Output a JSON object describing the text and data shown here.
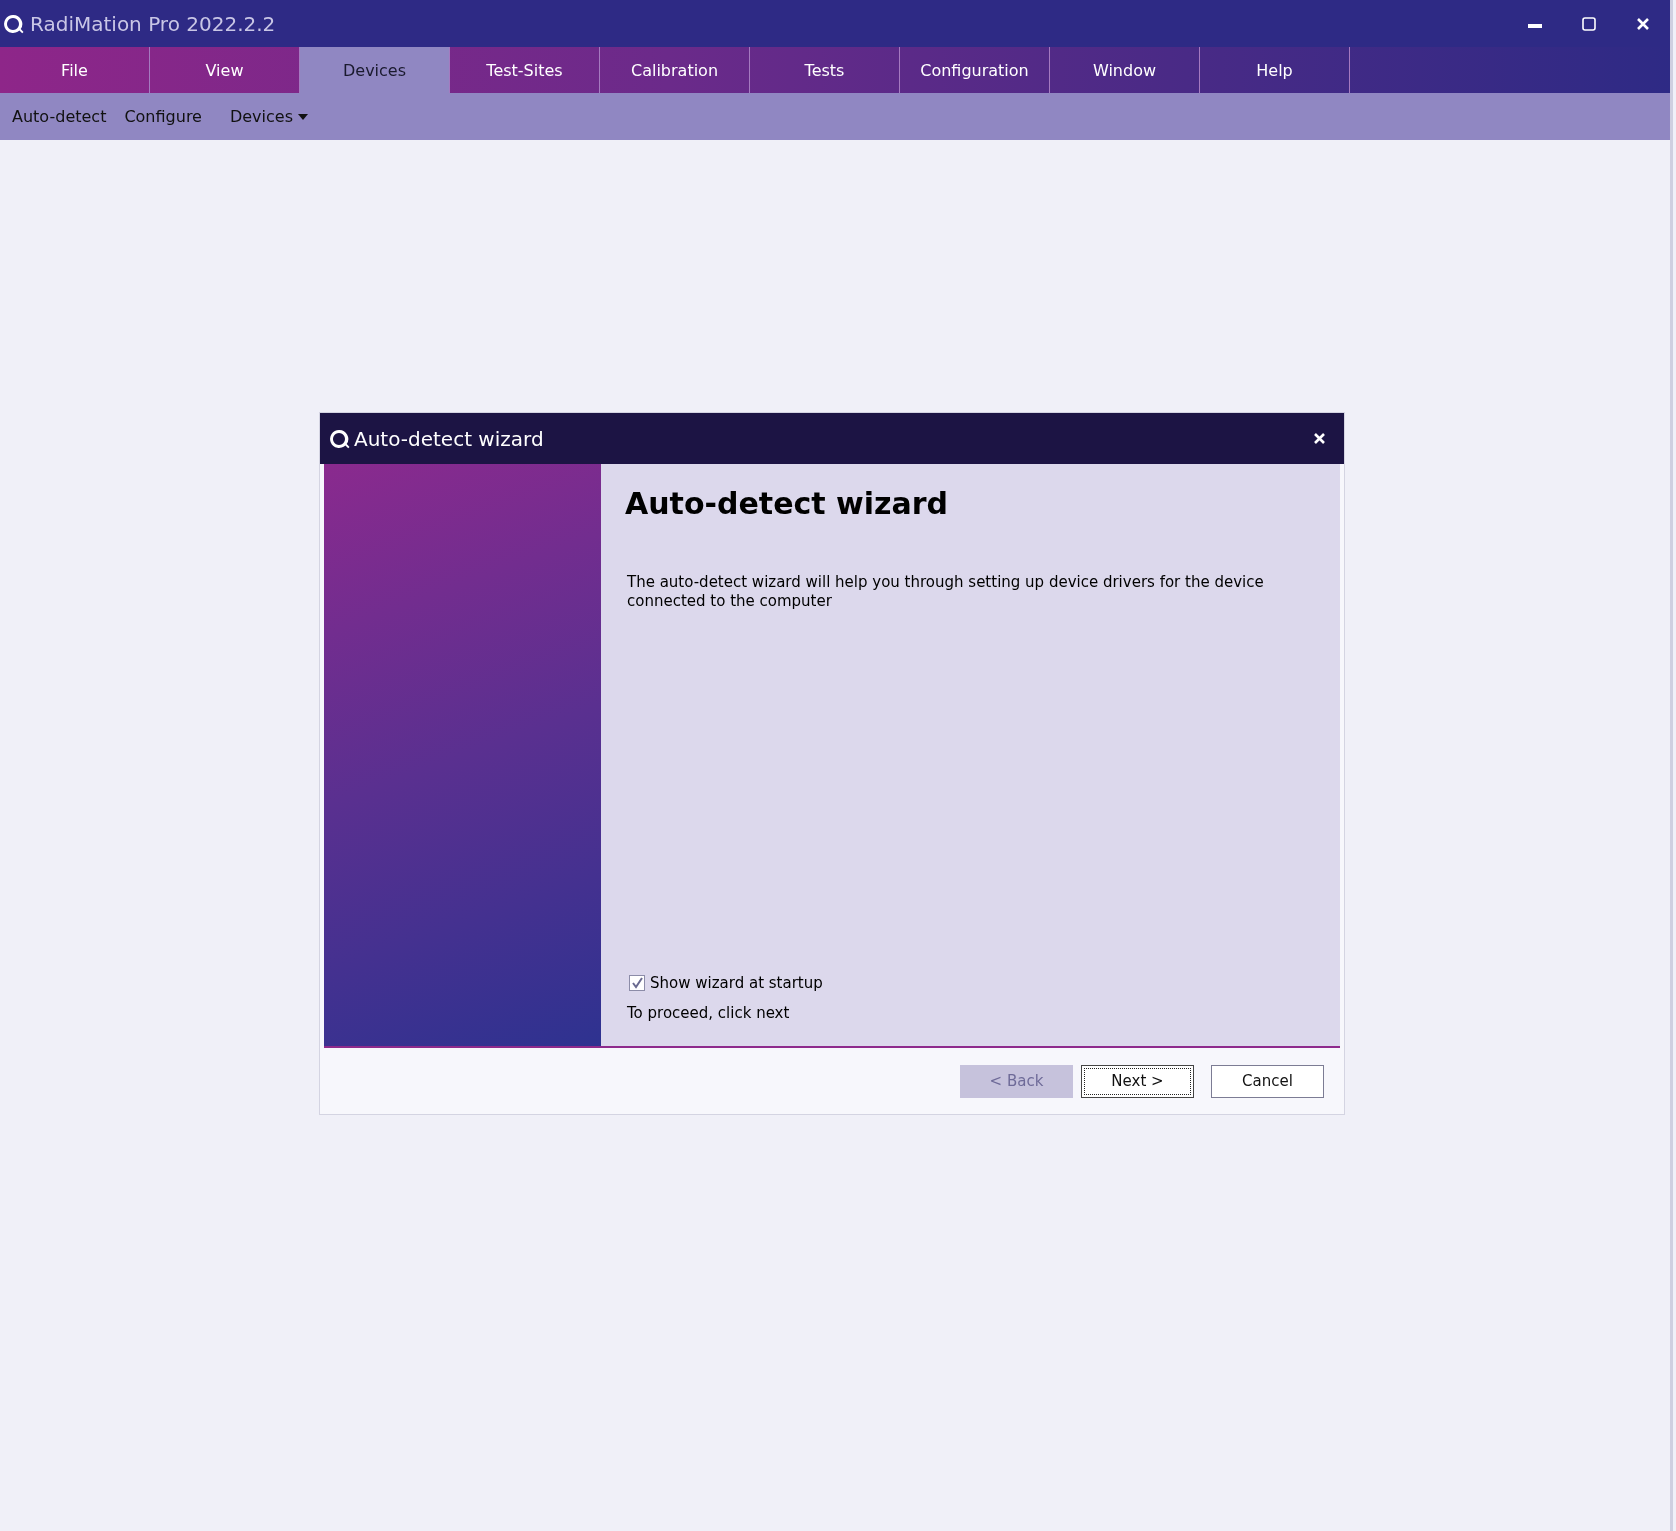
{
  "window": {
    "title": "RadiMation Pro 2022.2.2"
  },
  "menu_tabs": [
    {
      "label": "File",
      "selected": false
    },
    {
      "label": "View",
      "selected": false
    },
    {
      "label": "Devices",
      "selected": true
    },
    {
      "label": "Test-Sites",
      "selected": false
    },
    {
      "label": "Calibration",
      "selected": false
    },
    {
      "label": "Tests",
      "selected": false
    },
    {
      "label": "Configuration",
      "selected": false
    },
    {
      "label": "Window",
      "selected": false
    },
    {
      "label": "Help",
      "selected": false
    }
  ],
  "toolbar": [
    {
      "label": "Auto-detect",
      "kind": "button"
    },
    {
      "label": "Configure",
      "kind": "button"
    },
    {
      "label": "Devices",
      "kind": "dropdown"
    }
  ],
  "dialog": {
    "title": "Auto-detect wizard",
    "heading": "Auto-detect wizard",
    "description": "The auto-detect wizard will help you through setting up device drivers for the device connected to the computer",
    "show_at_startup": {
      "label": "Show wizard at startup",
      "checked": true
    },
    "instruction": "To proceed, click next",
    "buttons": [
      {
        "label": "< Back",
        "disabled": true,
        "default": false
      },
      {
        "label": "Next >",
        "disabled": false,
        "default": true
      },
      {
        "label": "Cancel",
        "disabled": false,
        "default": false
      }
    ]
  }
}
